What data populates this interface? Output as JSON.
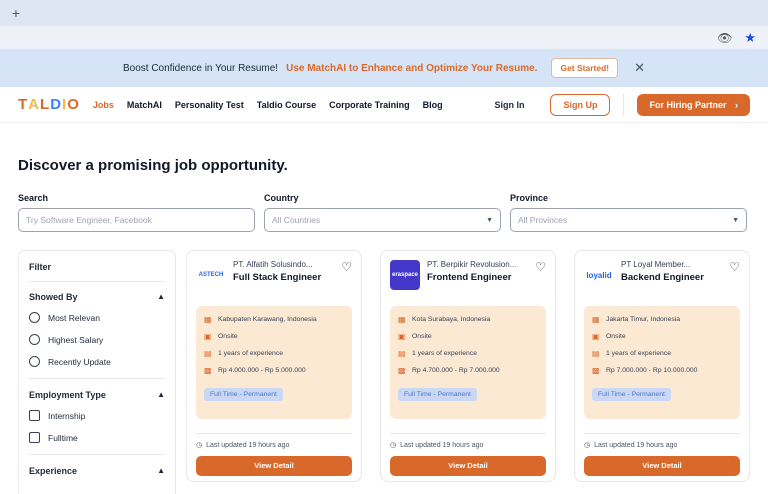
{
  "browser": {
    "new_tab": "+",
    "eye_icon": "eye-off-icon",
    "star_icon": "star-icon"
  },
  "promo": {
    "text": "Boost Confidence in Your Resume!",
    "highlight": "Use MatchAI to Enhance and Optimize Your Resume.",
    "button": "Get Started!",
    "close": "✕"
  },
  "nav": {
    "logo": [
      "T",
      "A",
      "L",
      "D",
      "I",
      "O"
    ],
    "links": [
      "Jobs",
      "MatchAI",
      "Personality Test",
      "Taldio Course",
      "Corporate Training",
      "Blog"
    ],
    "sign_in": "Sign In",
    "sign_up": "Sign Up",
    "hiring": "For Hiring Partner",
    "hiring_arrow": "›"
  },
  "page": {
    "title": "Discover a promising job opportunity."
  },
  "filters": {
    "search_label": "Search",
    "search_placeholder": "Try Software Engineer, Facebook",
    "country_label": "Country",
    "country_value": "All Countries",
    "province_label": "Province",
    "province_value": "All Provinces"
  },
  "sidebar": {
    "title": "Filter",
    "showed_by": "Showed By",
    "showed_options": [
      "Most Relevan",
      "Highest Salary",
      "Recently Update"
    ],
    "employment_type": "Employment Type",
    "employment_options": [
      "Internship",
      "Fulltime"
    ],
    "experience": "Experience"
  },
  "jobs": [
    {
      "logo": "ASTECH",
      "company": "PT. Alfatih Solusindo...",
      "title": "Full Stack Engineer",
      "location": "Kabupaten Karawang, Indonesia",
      "mode": "Onsite",
      "experience": "1 years of experience",
      "salary": "Rp 4.000.000 - Rp 5.000.000",
      "type": "Full Time - Permanent",
      "updated": "Last updated 19 hours ago",
      "button": "View Detail"
    },
    {
      "logo": "eraspace",
      "company": "PT. Berpikir Revolusion...",
      "title": "Frontend Engineer",
      "location": "Kota Surabaya, Indonesia",
      "mode": "Onsite",
      "experience": "1 years of experience",
      "salary": "Rp 4.700.000 - Rp 7.000.000",
      "type": "Full Time - Permanent",
      "updated": "Last updated 19 hours ago",
      "button": "View Detail"
    },
    {
      "logo": "loyalid",
      "company": "PT Loyal Member...",
      "title": "Backend Engineer",
      "location": "Jakarta Timur, Indonesia",
      "mode": "Onsite",
      "experience": "1 years of experience",
      "salary": "Rp 7.000.000 - Rp 10.000.000",
      "type": "Full Time - Permanent",
      "updated": "Last updated 19 hours ago",
      "button": "View Detail"
    }
  ],
  "colors": {
    "accent": "#d9692a",
    "banner": "#d6e4f7",
    "detail_bg": "#fbe9d4",
    "tag_bg": "#c9d8f5"
  }
}
